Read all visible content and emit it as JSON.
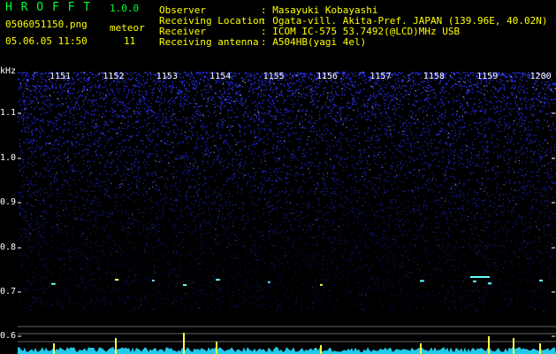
{
  "header": {
    "app_name": "H R O F F T",
    "version": "1.0.0",
    "filename": "0506051150.png",
    "meteor_label": "meteor",
    "meteor_count": "11",
    "datetime": "05.06.05 11:50",
    "fields": [
      {
        "label": "Observer",
        "value": ": Masayuki Kobayashi"
      },
      {
        "label": "Receiving Location",
        "value": ": Ogata-vill. Akita-Pref. JAPAN (139.96E, 40.02N)"
      },
      {
        "label": "Receiver",
        "value": ": ICOM IC-575 53.7492(@LCD)MHz USB"
      },
      {
        "label": "Receiving antenna",
        "value": ": A504HB(yagi 4el)"
      }
    ]
  },
  "axis": {
    "unit": "kHz",
    "y_ticks": [
      "1.1",
      "1.0",
      "0.9",
      "0.8",
      "0.7",
      "0.6"
    ],
    "time_ticks": [
      "1151",
      "1152",
      "1153",
      "1154",
      "1155",
      "1156",
      "1157",
      "1158",
      "1159",
      "1200"
    ]
  },
  "colors": {
    "background": "#000000",
    "header_green": "#00ff33",
    "header_yellow": "#ffff00",
    "noise_blue": "#2a35ff",
    "meteor_cyan": "#66ffff",
    "echo_yellow": "#ffff44"
  }
}
